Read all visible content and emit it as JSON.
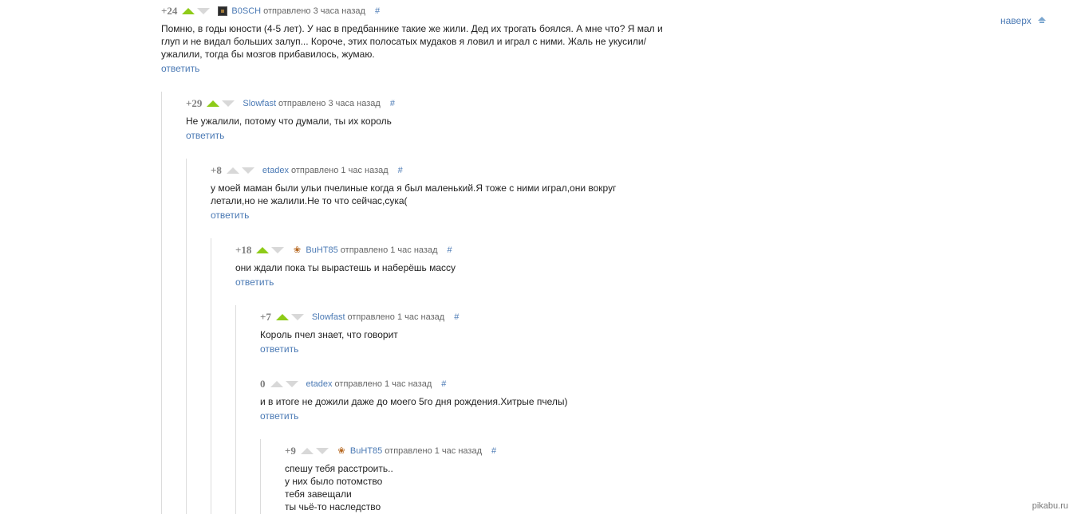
{
  "to_top": {
    "label": "наверх",
    "icon": "arrow-up-icon"
  },
  "watermark": "pikabu.ru",
  "colors": {
    "link": "#4a79b4",
    "vote_active": "#8ecb18",
    "vote_inactive": "#d8d8d8",
    "rating": "#7f7f7f"
  },
  "comments": [
    {
      "rating": "+24",
      "up_active": true,
      "avatar": "bosch-avatar-icon",
      "author": "B0SCH",
      "meta": "отправлено 3 часа назад",
      "hash": "#",
      "lines": [
        "Помню, в годы юности (4-5 лет). У нас в предбаннике такие же жили. Дед их трогать боялся. А мне что? Я мал и",
        "глуп и не видал больших залуп... Короче, этих полосатых мудаков я ловил и играл с ними. Жаль не укусили/",
        "ужалили, тогда бы мозгов прибавилось, жумаю."
      ],
      "reply": "ответить"
    },
    {
      "rating": "+29",
      "up_active": true,
      "avatar": "",
      "author": "Slowfast",
      "meta": "отправлено 3 часа назад",
      "hash": "#",
      "lines": [
        "Не ужалили, потому что думали, ты их король"
      ],
      "reply": "ответить"
    },
    {
      "rating": "+8",
      "up_active": false,
      "avatar": "",
      "author": "etadex",
      "meta": "отправлено 1 час назад",
      "hash": "#",
      "lines": [
        "у моей маман были ульи пчелиные когда я был маленький.Я тоже с ними играл,они вокруг",
        "летали,но не жалили.Не то что сейчас,сука("
      ],
      "reply": "ответить"
    },
    {
      "rating": "+18",
      "up_active": true,
      "avatar": "fox-avatar-icon",
      "author": "BuHT85",
      "meta": "отправлено 1 час назад",
      "hash": "#",
      "lines": [
        "они ждали пока ты вырастешь и наберёшь массу"
      ],
      "reply": "ответить"
    },
    {
      "rating": "+7",
      "up_active": true,
      "avatar": "",
      "author": "Slowfast",
      "meta": "отправлено 1 час назад",
      "hash": "#",
      "lines": [
        "Король пчел знает, что говорит"
      ],
      "reply": "ответить"
    },
    {
      "rating": "0",
      "up_active": false,
      "avatar": "",
      "author": "etadex",
      "meta": "отправлено 1 час назад",
      "hash": "#",
      "lines": [
        "и в итоге не дожили даже до моего 5го дня рождения.Хитрые пчелы)"
      ],
      "reply": "ответить"
    },
    {
      "rating": "+9",
      "up_active": false,
      "avatar": "fox-avatar-icon",
      "author": "BuHT85",
      "meta": "отправлено 1 час назад",
      "hash": "#",
      "lines": [
        "спешу тебя расстроить..",
        "у них было потомство",
        "тебя завещали",
        "ты чьё-то наследство"
      ],
      "reply": ""
    }
  ]
}
